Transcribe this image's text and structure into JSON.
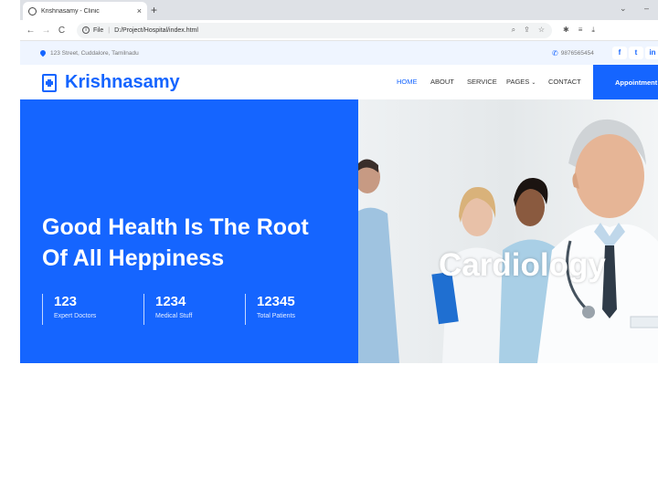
{
  "browser": {
    "tab_title": "Krishnasamy - Clinic",
    "tab_close": "×",
    "new_tab": "+",
    "address_label": "File",
    "url": "D:/Project/Hospital/index.html"
  },
  "topbar": {
    "address": "123 Street, Cuddalore, Tamilnadu",
    "phone": "9876565454",
    "social": [
      "f",
      "t",
      "in"
    ]
  },
  "navbar": {
    "brand": "Krishnasamy",
    "menu": [
      "HOME",
      "ABOUT",
      "SERVICE",
      "PAGES",
      "CONTACT"
    ],
    "appointment_button": "Appointment"
  },
  "hero": {
    "title_line1": "Good Health Is The Root",
    "title_line2": "Of All Heppiness",
    "stats": [
      {
        "value": "123",
        "label": "Expert Doctors"
      },
      {
        "value": "1234",
        "label": "Medical Stuff"
      },
      {
        "value": "12345",
        "label": "Total Patients"
      }
    ],
    "image_caption": "Cardiology"
  },
  "colors": {
    "accent": "#1565ff",
    "topbar_bg": "#eff5ff"
  }
}
